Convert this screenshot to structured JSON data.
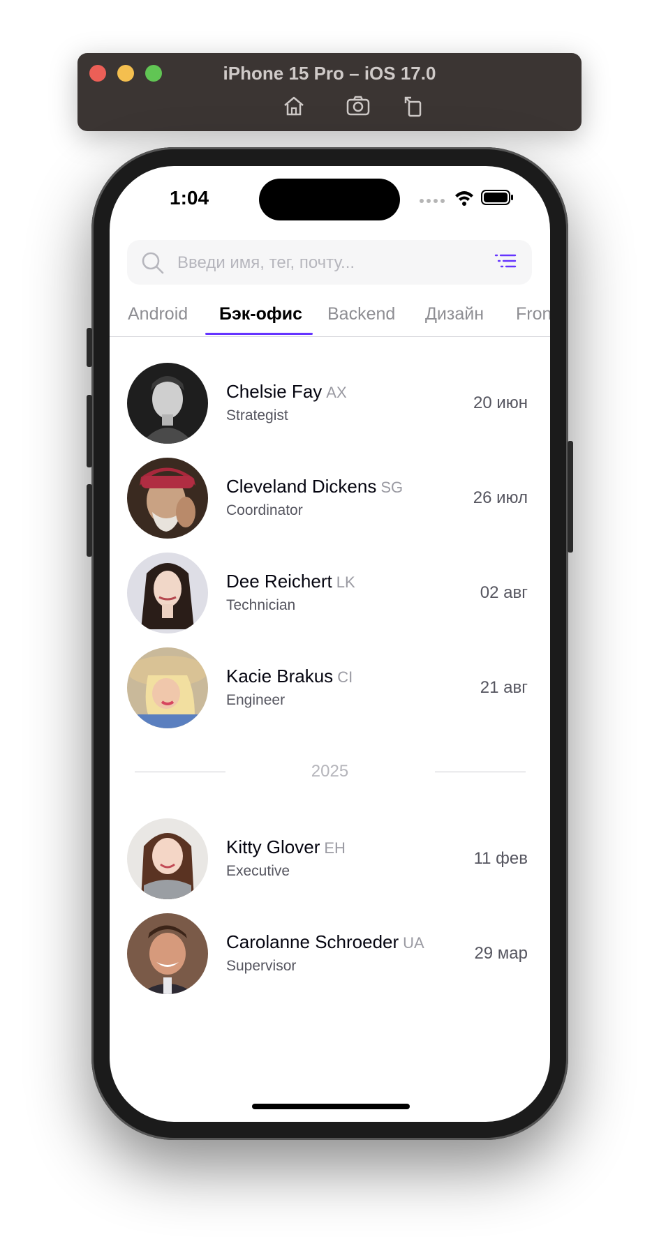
{
  "simulator": {
    "title": "iPhone 15 Pro – iOS 17.0",
    "tools": [
      "home-icon",
      "screenshot-icon",
      "rotate-icon"
    ]
  },
  "status_bar": {
    "time": "1:04"
  },
  "search": {
    "placeholder": "Введи имя, тег, почту..."
  },
  "tabs": [
    {
      "label": "Android",
      "active": false
    },
    {
      "label": "Бэк-офис",
      "active": true
    },
    {
      "label": "Backend",
      "active": false
    },
    {
      "label": "Дизайн",
      "active": false
    },
    {
      "label": "Frontend",
      "active": false
    }
  ],
  "accent_color": "#6534ff",
  "people": [
    {
      "name": "Chelsie Fay",
      "tag": "AX",
      "role": "Strategist",
      "date": "20 июн"
    },
    {
      "name": "Cleveland Dickens",
      "tag": "SG",
      "role": "Coordinator",
      "date": "26 июл"
    },
    {
      "name": "Dee Reichert",
      "tag": "LK",
      "role": "Technician",
      "date": "02 авг"
    },
    {
      "name": "Kacie Brakus",
      "tag": "CI",
      "role": "Engineer",
      "date": "21 авг"
    }
  ],
  "year_separator": "2025",
  "people_next_year": [
    {
      "name": "Kitty Glover",
      "tag": "EH",
      "role": "Executive",
      "date": "11 фев"
    },
    {
      "name": "Carolanne Schroeder",
      "tag": "UA",
      "role": "Supervisor",
      "date": "29 мар"
    }
  ]
}
